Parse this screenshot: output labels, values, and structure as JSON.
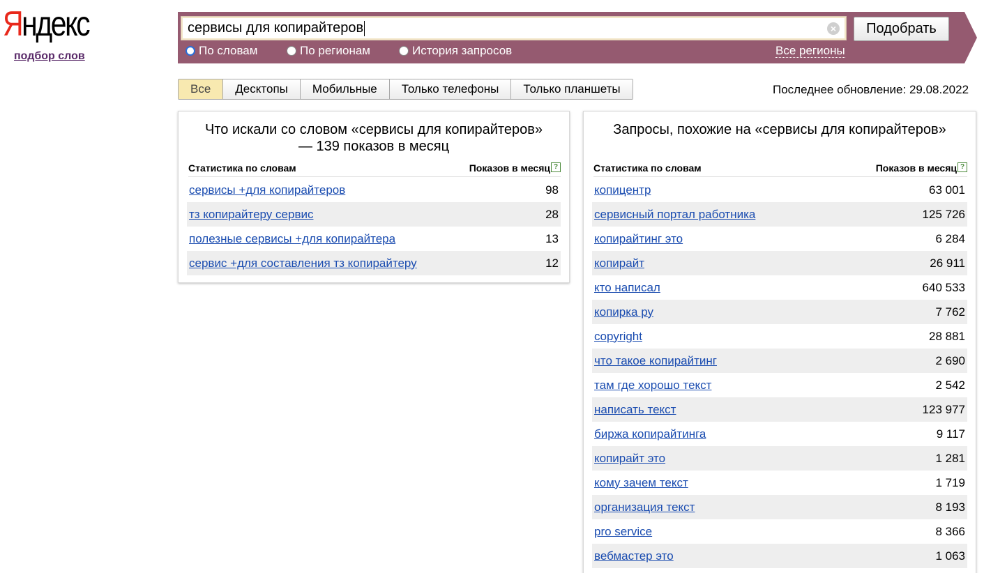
{
  "logo": {
    "first_letter": "Я",
    "rest": "ндекс",
    "subtitle": "подбор слов"
  },
  "search": {
    "query": "сервисы для копирайтеров",
    "submit_label": "Подобрать",
    "clear_glyph": "×",
    "modes": [
      {
        "label": "По словам",
        "checked": true
      },
      {
        "label": "По регионам",
        "checked": false
      },
      {
        "label": "История запросов",
        "checked": false
      }
    ],
    "regions_link": "Все регионы"
  },
  "device_tabs": [
    "Все",
    "Десктопы",
    "Мобильные",
    "Только телефоны",
    "Только планшеты"
  ],
  "active_tab": "Все",
  "last_update": "Последнее обновление: 29.08.2022",
  "left_panel": {
    "title": "Что искали со словом «сервисы для копирайтеров» — 139 показов в месяц",
    "col_words": "Статистика по словам",
    "col_count": "Показов в месяц",
    "help_glyph": "?",
    "rows": [
      {
        "keyword": "сервисы +для копирайтеров",
        "count": "98"
      },
      {
        "keyword": "тз копирайтеру сервис",
        "count": "28"
      },
      {
        "keyword": "полезные сервисы +для копирайтера",
        "count": "13"
      },
      {
        "keyword": "сервис +для составления тз копирайтеру",
        "count": "12"
      }
    ]
  },
  "right_panel": {
    "title": "Запросы, похожие на «сервисы для копирайтеров»",
    "col_words": "Статистика по словам",
    "col_count": "Показов в месяц",
    "help_glyph": "?",
    "rows": [
      {
        "keyword": "копицентр",
        "count": "63 001"
      },
      {
        "keyword": "сервисный портал работника",
        "count": "125 726"
      },
      {
        "keyword": "копирайтинг это",
        "count": "6 284"
      },
      {
        "keyword": "копирайт",
        "count": "26 911"
      },
      {
        "keyword": "кто написал",
        "count": "640 533"
      },
      {
        "keyword": "копирка ру",
        "count": "7 762"
      },
      {
        "keyword": "copyright",
        "count": "28 881"
      },
      {
        "keyword": "что такое копирайтинг",
        "count": "2 690"
      },
      {
        "keyword": "там где хорошо текст",
        "count": "2 542"
      },
      {
        "keyword": "написать текст",
        "count": "123 977"
      },
      {
        "keyword": "биржа копирайтинга",
        "count": "9 117"
      },
      {
        "keyword": "копирайт это",
        "count": "1 281"
      },
      {
        "keyword": "кому зачем текст",
        "count": "1 719"
      },
      {
        "keyword": "организация текст",
        "count": "8 193"
      },
      {
        "keyword": "pro service",
        "count": "8 366"
      },
      {
        "keyword": "вебмастер это",
        "count": "1 063"
      }
    ]
  },
  "colors": {
    "band": "#955a70",
    "link": "#1a4cb0",
    "logo_red": "#e8281b",
    "active_tab": "#f8e9b0"
  }
}
